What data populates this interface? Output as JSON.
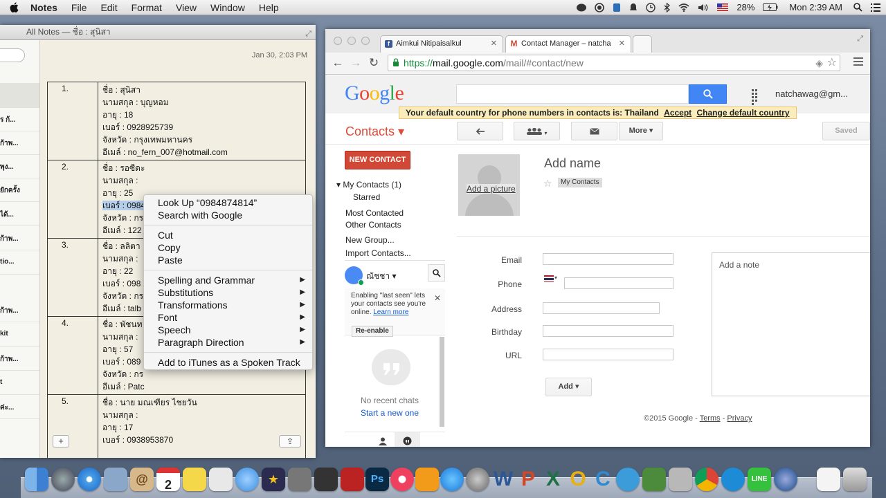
{
  "menubar": {
    "apple": "",
    "app": "Notes",
    "items": [
      "File",
      "Edit",
      "Format",
      "View",
      "Window",
      "Help"
    ],
    "battery": "28%",
    "clock": "Mon 2:39 AM"
  },
  "notes": {
    "window_title": "All Notes — ชื่อ : สุนิสา",
    "date": "Jan 30, 2:03 PM",
    "list_items": [
      "ร ก้...",
      "ก้าพ...",
      "พุง...",
      "ยักครั้ง",
      "ได้...",
      "ก้าพ...",
      "tio...",
      "ก้าพ...",
      "kit",
      "ก้าพ...",
      "t",
      "ค่ะ..."
    ],
    "rows": [
      {
        "num": "1.",
        "lines": [
          "ชื่อ : สุนิสา",
          "นามสกุล : บุญหอม",
          "อายุ : 18",
          "เบอร์ : 0928925739",
          "จังหวัด : กรุงเทพมหานคร",
          "อีเมล์ : no_fern_007@hotmail.com"
        ]
      },
      {
        "num": "2.",
        "lines": [
          "ชื่อ : รอซีดะ",
          "นามสกุล :",
          "อายุ : 25",
          "เบอร์ : 0984874814",
          "จังหวัด : กร",
          "อีเมล์ : 122"
        ]
      },
      {
        "num": "3.",
        "lines": [
          "ชื่อ : ลลิตา",
          "นามสกุล :",
          "อายุ : 22",
          "เบอร์ : 098",
          "จังหวัด : กร",
          "อีเมล์ : talb"
        ]
      },
      {
        "num": "4.",
        "lines": [
          "ชื่อ : พัชนท",
          "นามสกุล :",
          "อายุ : 57",
          "เบอร์ : 089",
          "จังหวัด : กร",
          "อีเมล์ : Patc"
        ]
      },
      {
        "num": "5.",
        "lines": [
          "ชื่อ : นาย มณเฑียร ไชยวัน",
          "นามสกุล :",
          "อายุ : 17",
          "เบอร์ : 0938953870"
        ]
      }
    ],
    "add_label": "+",
    "share_label": "⇪"
  },
  "context_menu": {
    "group1": [
      "Look Up “0984874814”",
      "Search with Google"
    ],
    "group2": [
      "Cut",
      "Copy",
      "Paste"
    ],
    "group3": [
      "Spelling and Grammar",
      "Substitutions",
      "Transformations",
      "Font",
      "Speech",
      "Paragraph Direction"
    ],
    "group4": [
      "Add to iTunes as a Spoken Track"
    ]
  },
  "chrome": {
    "tabs": [
      "Aimkui Nitipaisalkul",
      "Contact Manager – natcha"
    ],
    "url_scheme": "https://",
    "url_host": "mail.google.com",
    "url_path": "/mail/#contact/new"
  },
  "gmail": {
    "logo": [
      "G",
      "o",
      "o",
      "g",
      "l",
      "e"
    ],
    "logo_colors": [
      "#4285f4",
      "#ea4335",
      "#fbbc05",
      "#4285f4",
      "#34a853",
      "#ea4335"
    ],
    "user": "natchawag@gm...",
    "notice": {
      "text": "Your default country for phone numbers in contacts is: Thailand",
      "accept": "Accept",
      "change": "Change default country"
    },
    "contacts_label": "Contacts ▾",
    "more_label": "More ▾",
    "saved_label": "Saved",
    "new_contact": "NEW CONTACT",
    "nav": {
      "my_contacts": "▾  My Contacts (1)",
      "starred": "Starred",
      "most": "Most Contacted",
      "other": "Other Contacts",
      "new_group": "New Group...",
      "import": "Import Contacts..."
    },
    "chat": {
      "name": "ณัชชา ▾",
      "hint": "Enabling \"last seen\" lets your contacts see you're online.",
      "learn": "Learn more",
      "reenable": "Re-enable",
      "no_recent": "No recent chats",
      "start_new": "Start a new one"
    },
    "contact_form": {
      "add_picture": "Add a picture",
      "add_name": "Add name",
      "my_contacts_chip": "My Contacts",
      "labels": [
        "Email",
        "Phone",
        "Address",
        "Birthday",
        "URL"
      ],
      "add_button": "Add ▾",
      "note_placeholder": "Add a note"
    },
    "footer": {
      "copy": "©2015 Google - ",
      "terms": "Terms",
      "sep": " - ",
      "privacy": "Privacy"
    }
  },
  "dock": {
    "apps": [
      "finder",
      "launchpad",
      "safari",
      "mail",
      "contacts",
      "calendar",
      "notes",
      "preview",
      "messages",
      "imovie",
      "calculator",
      "photo-booth",
      "photo",
      "photoshop",
      "itunes",
      "ibooks",
      "app-store",
      "system-preferences",
      "word",
      "powerpoint",
      "excel",
      "outlook",
      "onenote",
      "hands",
      "network",
      "tools",
      "chrome",
      "teamviewer",
      "line",
      "quicktime",
      "document",
      "trash"
    ],
    "calendar_day": "2"
  }
}
